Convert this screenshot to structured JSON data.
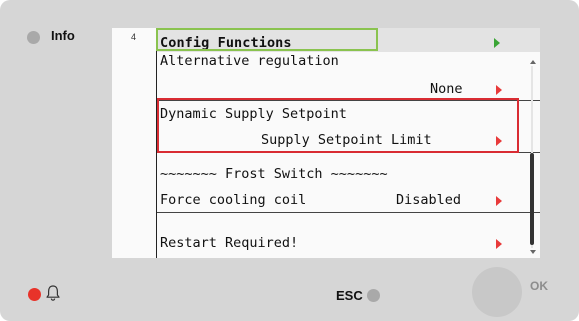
{
  "side": {
    "info_label": "Info",
    "esc_label": "ESC",
    "ok_label": "OK"
  },
  "screen": {
    "line_number": "4",
    "header": "Config Functions",
    "rows": {
      "alt_regulation_label": "Alternative regulation",
      "alt_regulation_value": "None",
      "dynamic_supply_label": "Dynamic Supply Setpoint",
      "dynamic_supply_value": "Supply Setpoint Limit",
      "frost_switch_header": "~~~~~~~ Frost Switch ~~~~~~~",
      "force_cooling_label": "Force cooling coil",
      "force_cooling_value": "Disabled",
      "restart_label": "Restart Required!"
    }
  },
  "colors": {
    "panel": "#d6d6d6",
    "focus_green": "#8ac34f",
    "highlight_red": "#d92c33",
    "arrow_green": "#3aa535",
    "arrow_red": "#e83a3a",
    "alarm_led": "#e8332a"
  },
  "icons": {
    "info_led": "info-led-icon",
    "alarm_led": "alarm-led-icon",
    "bell": "bell-icon",
    "esc": "esc-button-icon",
    "ok": "ok-button-icon"
  }
}
